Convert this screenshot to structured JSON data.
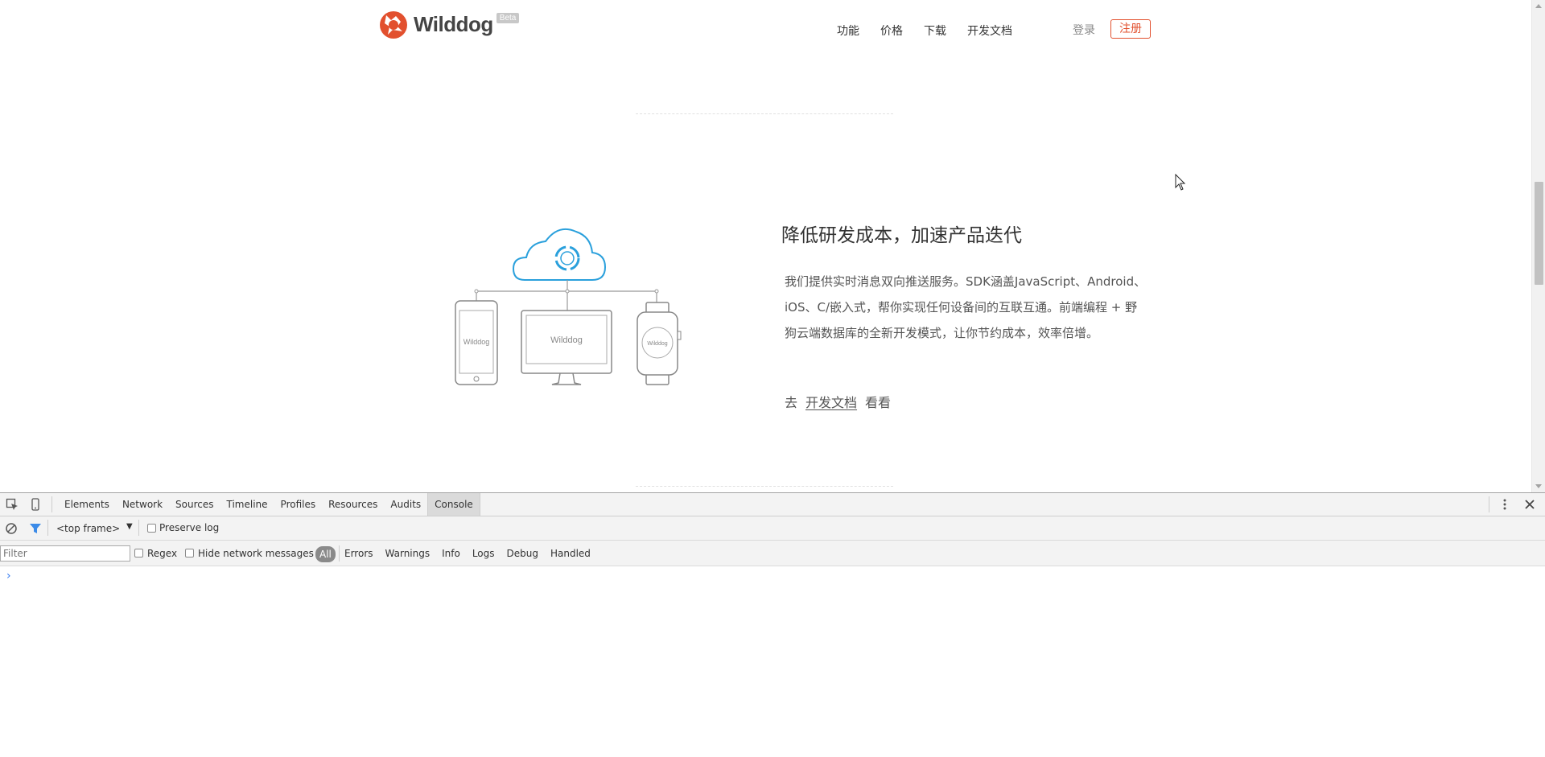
{
  "header": {
    "logo_text": "Wilddog",
    "beta_badge": "Beta",
    "nav": [
      "功能",
      "价格",
      "下载",
      "开发文档"
    ],
    "login": "登录",
    "register": "注册"
  },
  "illustration": {
    "phone_label": "Wilddog",
    "monitor_label": "Wilddog",
    "watch_label": "Wilddog"
  },
  "feature": {
    "title": "降低研发成本，加速产品迭代",
    "body": "我们提供实时消息双向推送服务。SDK涵盖JavaScript、Android、iOS、C/嵌入式，帮你实现任何设备间的互联互通。前端编程 + 野狗云端数据库的全新开发模式，让你节约成本，效率倍增。",
    "link_prefix": "去",
    "link_text": "开发文档",
    "link_suffix": "看看"
  },
  "devtools": {
    "tabs": [
      "Elements",
      "Network",
      "Sources",
      "Timeline",
      "Profiles",
      "Resources",
      "Audits",
      "Console"
    ],
    "active_tab": "Console",
    "frame_select": "<top frame>",
    "preserve_log": "Preserve log",
    "filter_placeholder": "Filter",
    "regex": "Regex",
    "hide_network": "Hide network messages",
    "level_all": "All",
    "levels": [
      "Errors",
      "Warnings",
      "Info",
      "Logs",
      "Debug",
      "Handled"
    ],
    "prompt": "›"
  },
  "colors": {
    "brand_red": "#e2502e",
    "cloud_blue": "#2aa0dc"
  }
}
